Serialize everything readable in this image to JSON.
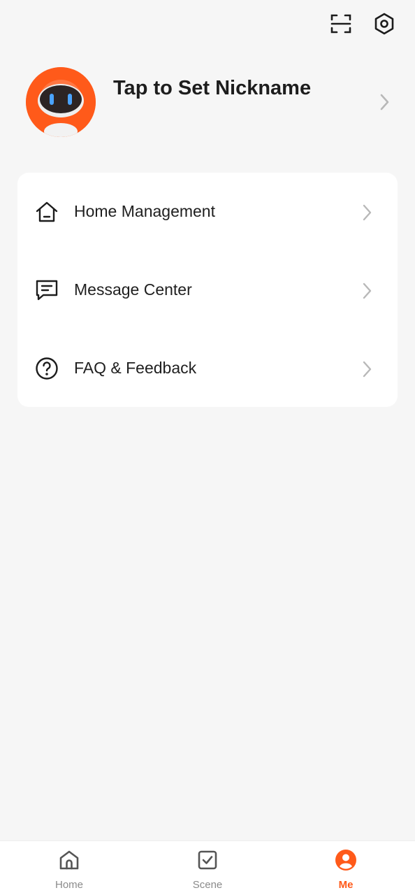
{
  "header": {
    "scan_icon": "scan-icon",
    "settings_icon": "settings-hexagon-icon"
  },
  "profile": {
    "nickname": "Tap to Set Nickname",
    "avatar": "robot-avatar"
  },
  "menu": {
    "items": [
      {
        "label": "Home Management",
        "icon": "house-icon"
      },
      {
        "label": "Message Center",
        "icon": "message-icon"
      },
      {
        "label": "FAQ & Feedback",
        "icon": "question-circle-icon"
      }
    ]
  },
  "tabbar": {
    "tabs": [
      {
        "label": "Home",
        "icon": "home-icon",
        "active": false
      },
      {
        "label": "Scene",
        "icon": "scene-checkbox-icon",
        "active": false
      },
      {
        "label": "Me",
        "icon": "person-icon",
        "active": true
      }
    ]
  },
  "colors": {
    "accent": "#ff5a1a",
    "background": "#f6f6f6",
    "card": "#ffffff",
    "inactive_tab": "#8a8a8a"
  }
}
